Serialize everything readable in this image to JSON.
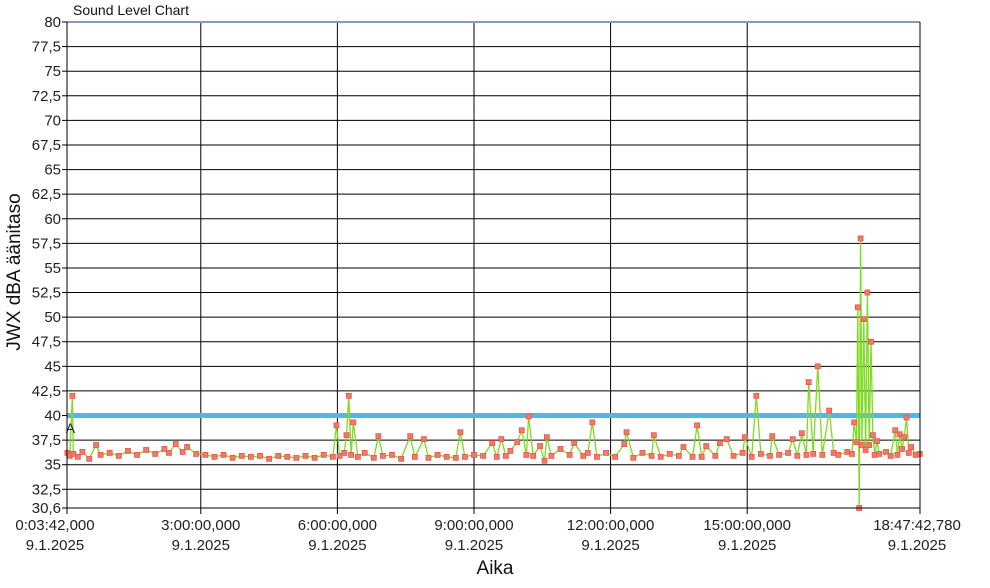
{
  "chart_data": {
    "type": "line",
    "title": "Sound Level Chart",
    "xlabel": "Aika",
    "ylabel": "JWX dBA äänitaso",
    "ylim": [
      30.6,
      80
    ],
    "y_ticks": [
      "30,6",
      "32,5",
      "35",
      "37,5",
      "40",
      "42,5",
      "45",
      "47,5",
      "50",
      "52,5",
      "55",
      "57,5",
      "60",
      "62,5",
      "65",
      "67,5",
      "70",
      "72,5",
      "75",
      "77,5",
      "80"
    ],
    "y_tick_values": [
      30.6,
      32.5,
      35,
      37.5,
      40,
      42.5,
      45,
      47.5,
      50,
      52.5,
      55,
      57.5,
      60,
      62.5,
      65,
      67.5,
      70,
      72.5,
      75,
      77.5,
      80
    ],
    "xlim_hours": [
      0.06167,
      18.79521
    ],
    "x_ticks": [
      {
        "hours": 0.06167,
        "time": "0:03:42,000",
        "date": "9.1.2025"
      },
      {
        "hours": 3,
        "time": "3:00:00,000",
        "date": "9.1.2025"
      },
      {
        "hours": 6,
        "time": "6:00:00,000",
        "date": "9.1.2025"
      },
      {
        "hours": 9,
        "time": "9:00:00,000",
        "date": "9.1.2025"
      },
      {
        "hours": 12,
        "time": "12:00:00,000",
        "date": "9.1.2025"
      },
      {
        "hours": 15,
        "time": "15:00:00,000",
        "date": "9.1.2025"
      },
      {
        "hours": 18.79521,
        "time": "18:47:42,780",
        "date": "9.1.2025"
      }
    ],
    "reference_line": {
      "value": 40,
      "color": "#4db8ec"
    },
    "marker_label": {
      "text": "A",
      "hours": 0.1,
      "value": 38.2
    },
    "grid": true,
    "colors": {
      "line": "#7ddc1f",
      "marker": "#e8574a",
      "marker_fill": "#f07a6a"
    },
    "series": [
      {
        "points": [
          [
            0.07,
            36.2
          ],
          [
            0.12,
            35.9
          ],
          [
            0.18,
            42.0
          ],
          [
            0.2,
            36.1
          ],
          [
            0.3,
            35.8
          ],
          [
            0.4,
            36.3
          ],
          [
            0.55,
            35.6
          ],
          [
            0.7,
            37.0
          ],
          [
            0.8,
            36.0
          ],
          [
            1.0,
            36.2
          ],
          [
            1.2,
            35.9
          ],
          [
            1.4,
            36.4
          ],
          [
            1.6,
            36.0
          ],
          [
            1.8,
            36.5
          ],
          [
            2.0,
            36.1
          ],
          [
            2.2,
            36.6
          ],
          [
            2.3,
            36.2
          ],
          [
            2.45,
            37.1
          ],
          [
            2.6,
            36.3
          ],
          [
            2.7,
            36.8
          ],
          [
            2.9,
            36.1
          ],
          [
            3.1,
            36.0
          ],
          [
            3.3,
            35.8
          ],
          [
            3.5,
            36.0
          ],
          [
            3.7,
            35.7
          ],
          [
            3.9,
            35.9
          ],
          [
            4.1,
            35.8
          ],
          [
            4.3,
            35.9
          ],
          [
            4.5,
            35.6
          ],
          [
            4.7,
            35.9
          ],
          [
            4.9,
            35.8
          ],
          [
            5.1,
            35.7
          ],
          [
            5.3,
            35.9
          ],
          [
            5.5,
            35.7
          ],
          [
            5.7,
            36.0
          ],
          [
            5.9,
            35.8
          ],
          [
            5.98,
            39.0
          ],
          [
            6.05,
            35.9
          ],
          [
            6.15,
            36.2
          ],
          [
            6.2,
            38.0
          ],
          [
            6.25,
            42.0
          ],
          [
            6.3,
            36.0
          ],
          [
            6.35,
            39.3
          ],
          [
            6.45,
            35.8
          ],
          [
            6.6,
            36.2
          ],
          [
            6.8,
            35.7
          ],
          [
            6.9,
            37.9
          ],
          [
            7.0,
            35.9
          ],
          [
            7.2,
            36.0
          ],
          [
            7.4,
            35.6
          ],
          [
            7.6,
            37.9
          ],
          [
            7.7,
            35.8
          ],
          [
            7.9,
            37.6
          ],
          [
            8.0,
            35.7
          ],
          [
            8.2,
            36.0
          ],
          [
            8.4,
            35.8
          ],
          [
            8.6,
            35.7
          ],
          [
            8.7,
            38.3
          ],
          [
            8.8,
            35.8
          ],
          [
            9.0,
            36.0
          ],
          [
            9.2,
            35.9
          ],
          [
            9.4,
            37.2
          ],
          [
            9.5,
            35.8
          ],
          [
            9.6,
            37.6
          ],
          [
            9.7,
            35.9
          ],
          [
            9.8,
            36.4
          ],
          [
            9.95,
            37.3
          ],
          [
            10.05,
            38.5
          ],
          [
            10.15,
            36.0
          ],
          [
            10.2,
            39.9
          ],
          [
            10.3,
            35.9
          ],
          [
            10.45,
            36.9
          ],
          [
            10.55,
            35.4
          ],
          [
            10.6,
            37.8
          ],
          [
            10.7,
            35.9
          ],
          [
            10.9,
            36.6
          ],
          [
            11.1,
            36.0
          ],
          [
            11.2,
            37.2
          ],
          [
            11.4,
            35.9
          ],
          [
            11.5,
            36.2
          ],
          [
            11.6,
            39.3
          ],
          [
            11.7,
            35.8
          ],
          [
            11.9,
            36.2
          ],
          [
            12.1,
            35.8
          ],
          [
            12.3,
            37.1
          ],
          [
            12.35,
            38.3
          ],
          [
            12.5,
            35.7
          ],
          [
            12.7,
            36.2
          ],
          [
            12.9,
            35.9
          ],
          [
            12.95,
            38.0
          ],
          [
            13.1,
            35.8
          ],
          [
            13.3,
            36.1
          ],
          [
            13.5,
            35.9
          ],
          [
            13.6,
            36.8
          ],
          [
            13.8,
            35.8
          ],
          [
            13.9,
            39.0
          ],
          [
            14.0,
            35.8
          ],
          [
            14.1,
            36.9
          ],
          [
            14.3,
            35.9
          ],
          [
            14.4,
            37.2
          ],
          [
            14.55,
            37.6
          ],
          [
            14.7,
            35.9
          ],
          [
            14.9,
            36.2
          ],
          [
            14.95,
            37.8
          ],
          [
            15.1,
            35.8
          ],
          [
            15.2,
            42.0
          ],
          [
            15.3,
            36.1
          ],
          [
            15.5,
            35.9
          ],
          [
            15.55,
            37.9
          ],
          [
            15.7,
            36.0
          ],
          [
            15.9,
            36.2
          ],
          [
            16.0,
            37.6
          ],
          [
            16.1,
            35.9
          ],
          [
            16.2,
            38.2
          ],
          [
            16.3,
            36.0
          ],
          [
            16.35,
            43.4
          ],
          [
            16.45,
            36.1
          ],
          [
            16.55,
            45.0
          ],
          [
            16.65,
            36.0
          ],
          [
            16.8,
            40.5
          ],
          [
            16.9,
            36.2
          ],
          [
            17.0,
            36.0
          ],
          [
            17.2,
            36.3
          ],
          [
            17.3,
            36.1
          ],
          [
            17.35,
            39.3
          ],
          [
            17.4,
            37.3
          ],
          [
            17.43,
            51.0
          ],
          [
            17.46,
            30.6
          ],
          [
            17.49,
            58.0
          ],
          [
            17.52,
            37.0
          ],
          [
            17.56,
            49.8
          ],
          [
            17.6,
            36.5
          ],
          [
            17.64,
            52.5
          ],
          [
            17.68,
            37.0
          ],
          [
            17.72,
            47.5
          ],
          [
            17.76,
            38.0
          ],
          [
            17.8,
            36.0
          ],
          [
            17.85,
            37.4
          ],
          [
            17.9,
            36.1
          ],
          [
            18.05,
            36.3
          ],
          [
            18.15,
            35.9
          ],
          [
            18.25,
            38.5
          ],
          [
            18.3,
            36.0
          ],
          [
            18.35,
            38.1
          ],
          [
            18.4,
            36.6
          ],
          [
            18.45,
            37.8
          ],
          [
            18.5,
            39.8
          ],
          [
            18.55,
            36.2
          ],
          [
            18.6,
            36.8
          ],
          [
            18.7,
            36.0
          ],
          [
            18.79,
            36.1
          ]
        ]
      }
    ]
  }
}
